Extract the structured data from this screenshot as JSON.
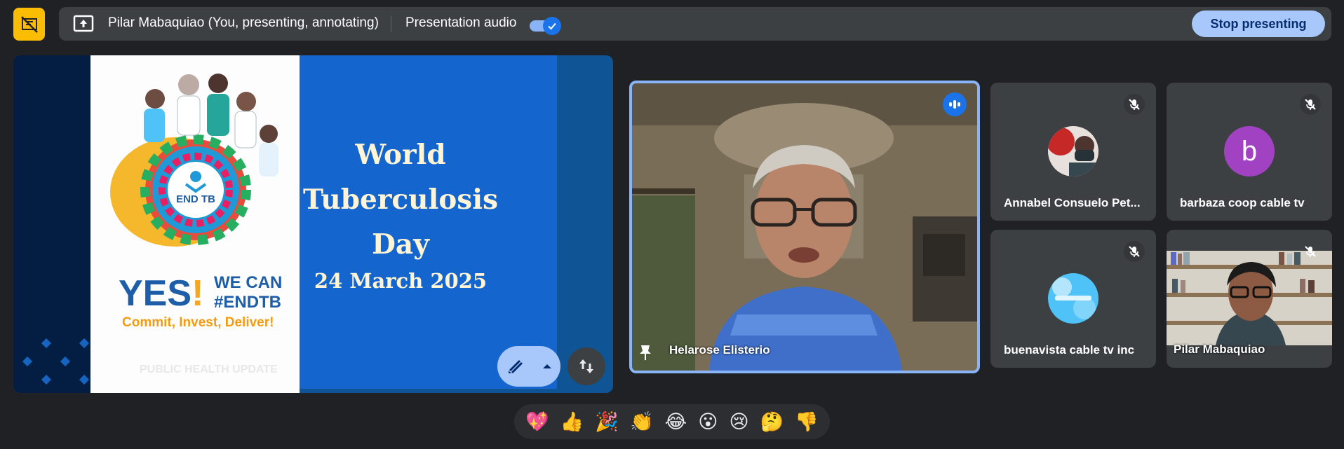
{
  "topbar": {
    "presenter_label": "Pilar Mabaquiao (You, presenting, annotating)",
    "audio_label": "Presentation audio",
    "audio_enabled": true,
    "stop_label": "Stop presenting"
  },
  "slide": {
    "title_line1": "World",
    "title_line2": "Tuberculosis",
    "title_line3": "Day",
    "date": "24 March 2025",
    "logo_text": "END TB",
    "yes": "YES",
    "yes_bang": "!",
    "wecan_line1": "WE CAN",
    "wecan_line2": "#ENDTB",
    "commit": "Commit, Invest, Deliver!",
    "footer": "PUBLIC HEALTH UPDATE"
  },
  "speaker": {
    "name": "Helarose Elisterio"
  },
  "participants": [
    {
      "name": "Annabel Consuelo Pet...",
      "muted": true
    },
    {
      "name": "barbaza coop cable tv",
      "muted": true,
      "initial": "b",
      "avatar_color": "#a142c2"
    },
    {
      "name": "buenavista cable tv inc",
      "muted": true
    },
    {
      "name": "Pilar Mabaquiao",
      "muted": true
    }
  ],
  "reactions": [
    "💖",
    "👍",
    "🎉",
    "👏",
    "😂",
    "😮",
    "😢",
    "🤔",
    "👎"
  ],
  "colors": {
    "background": "#202124",
    "accent": "#8ab4f8",
    "app_icon": "#fbbc04"
  }
}
